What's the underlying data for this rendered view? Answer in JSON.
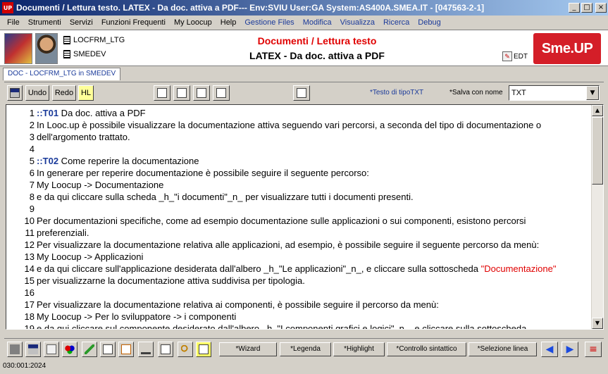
{
  "window": {
    "title": "Documenti / Lettura testo. LATEX - Da doc. attiva a PDF--- Env:SVIU User:GA System:AS400A.SMEA.IT - [047563-2-1]",
    "app_icon": "UP"
  },
  "menu": [
    {
      "label": "File",
      "color": "black"
    },
    {
      "label": "Strumenti",
      "color": "black"
    },
    {
      "label": "Servizi",
      "color": "black"
    },
    {
      "label": "Funzioni Frequenti",
      "color": "black"
    },
    {
      "label": "My Loocup",
      "color": "black"
    },
    {
      "label": "Help",
      "color": "black"
    },
    {
      "label": "Gestione Files",
      "color": "blue"
    },
    {
      "label": "Modifica",
      "color": "blue"
    },
    {
      "label": "Visualizza",
      "color": "blue"
    },
    {
      "label": "Ricerca",
      "color": "blue"
    },
    {
      "label": "Debug",
      "color": "blue"
    }
  ],
  "header": {
    "context1": "LOCFRM_LTG",
    "context2": "SMEDEV",
    "title_red": "Documenti / Lettura testo",
    "title_black": "LATEX - Da doc. attiva a PDF",
    "edt_label": "EDT",
    "brand": "Sme.UP"
  },
  "tab": {
    "label": "DOC - LOCFRM_LTG in SMEDEV"
  },
  "toolbar": {
    "undo": "Undo",
    "redo": "Redo",
    "hl": "HL",
    "text_type": "*Testo di tipoTXT",
    "save_label": "*Salva con nome",
    "save_value": "TXT"
  },
  "lines": [
    {
      "n": "1",
      "tag": "::T01",
      "text": " Da doc. attiva a PDF"
    },
    {
      "n": "2",
      "tag": "",
      "text": "In Looc.up è possibile visualizzare la documentazione attiva seguendo vari percorsi, a seconda del tipo di documentazione o"
    },
    {
      "n": "3",
      "tag": "",
      "text": "dell'argomento trattato."
    },
    {
      "n": "4",
      "tag": "",
      "text": ""
    },
    {
      "n": "5",
      "tag": "::T02",
      "text": " Come reperire la documentazione"
    },
    {
      "n": "6",
      "tag": "",
      "text": "In generare per reperire documentazione è possibile seguire il seguente percorso:"
    },
    {
      "n": "7",
      "tag": "",
      "text": "My Loocup -> Documentazione"
    },
    {
      "n": "8",
      "tag": "",
      "text": "e da qui cliccare sulla scheda _h_\"i documenti\"_n_ per visualizzare tutti i documenti presenti."
    },
    {
      "n": "9",
      "tag": "",
      "text": ""
    },
    {
      "n": "10",
      "tag": "",
      "text": "Per documentazioni specifiche, come ad esempio documentazione sulle applicazioni o sui componenti, esistono percorsi"
    },
    {
      "n": "11",
      "tag": "",
      "text": "preferenziali."
    },
    {
      "n": "12",
      "tag": "",
      "text": "Per visualizzare la documentazione relativa alle applicazioni, ad esempio, è possibile seguire il seguente percorso da menù:"
    },
    {
      "n": "13",
      "tag": "",
      "text": "My Loocup -> Applicazioni"
    },
    {
      "n": "14",
      "tag": "",
      "text": "e da qui cliccare sull'applicazione desiderata dall'albero _h_\"Le applicazioni\"_n_, e cliccare sulla sottoscheda ",
      "red": "\"Documentazione\""
    },
    {
      "n": "15",
      "tag": "",
      "text": "per visualizzarne la documentazione attiva suddivisa per tipologia."
    },
    {
      "n": "16",
      "tag": "",
      "text": ""
    },
    {
      "n": "17",
      "tag": "",
      "text": "Per visualizzare la documentazione relativa ai componenti, è possibile seguire il percorso da menù:"
    },
    {
      "n": "18",
      "tag": "",
      "text": "My Loocup -> Per lo sviluppatore -> i componenti"
    },
    {
      "n": "19",
      "tag": "",
      "text": "e da qui cliccare sul componente desiderato dall'albero _h_\"I componenti grafici e logici\"_n_, e cliccare sulla sottoscheda"
    }
  ],
  "bottom_buttons": {
    "wizard": "*Wizard",
    "legenda": "*Legenda",
    "highlight": "*Highlight",
    "controllo": "*Controllo sintattico",
    "selezione": "*Selezione linea"
  },
  "status": "030:001:2024",
  "colors": {
    "accent_red": "#e00000",
    "tag_blue": "#1a3a9a",
    "brand_red": "#d41e28"
  }
}
